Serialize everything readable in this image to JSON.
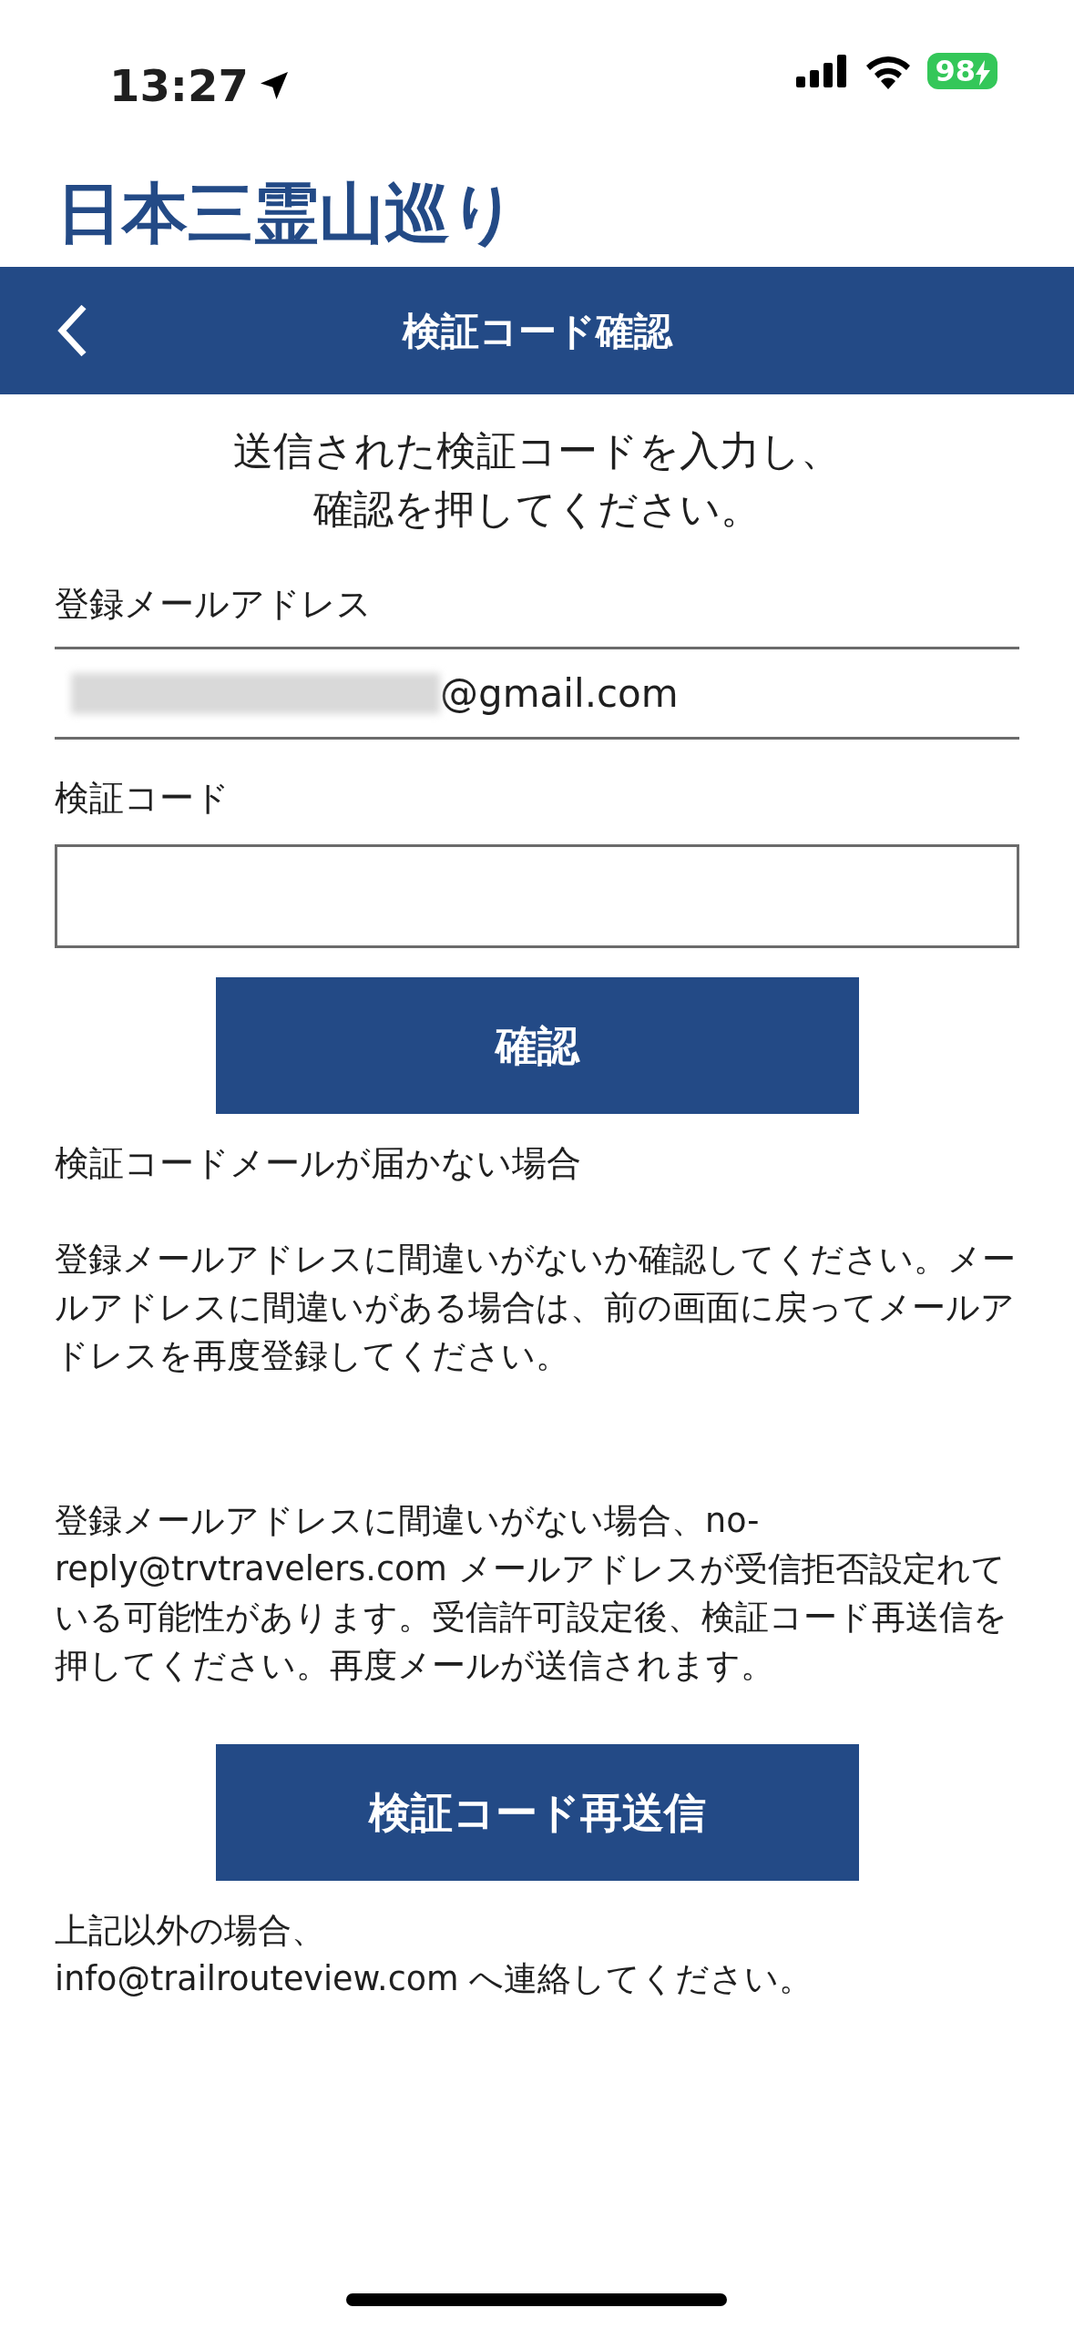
{
  "status_bar": {
    "time": "13:27",
    "battery": "98"
  },
  "app_title": "日本三霊山巡り",
  "nav_bar": {
    "title": "検証コード確認"
  },
  "instruction": [
    "送信された検証コードを入力し、",
    "確認を押してください。"
  ],
  "email_field": {
    "label": "登録メールアドレス",
    "value": "@gmail.com",
    "redacted": true
  },
  "code_field": {
    "label": "検証コード"
  },
  "confirm_button": "確認",
  "help_heading": "検証コードメールが届かない場合",
  "help_paragraphs": [
    "登録メールアドレスに間違いがないか確認してください。メールアドレスに間違いがある場合は、前の画面に戻ってメールアドレスを再度登録してください。",
    "登録メールアドレスに間違いがない場合、no-reply@trvtravelers.com メールアドレスが受信拒否設定れている可能性があります。受信許可設定後、検証コード再送信を押してください。再度メールが送信されます。"
  ],
  "resend_button": "検証コード再送信",
  "footer_note": [
    "上記以外の場合、",
    "info@trailrouteview.com へ連絡してください。"
  ]
}
